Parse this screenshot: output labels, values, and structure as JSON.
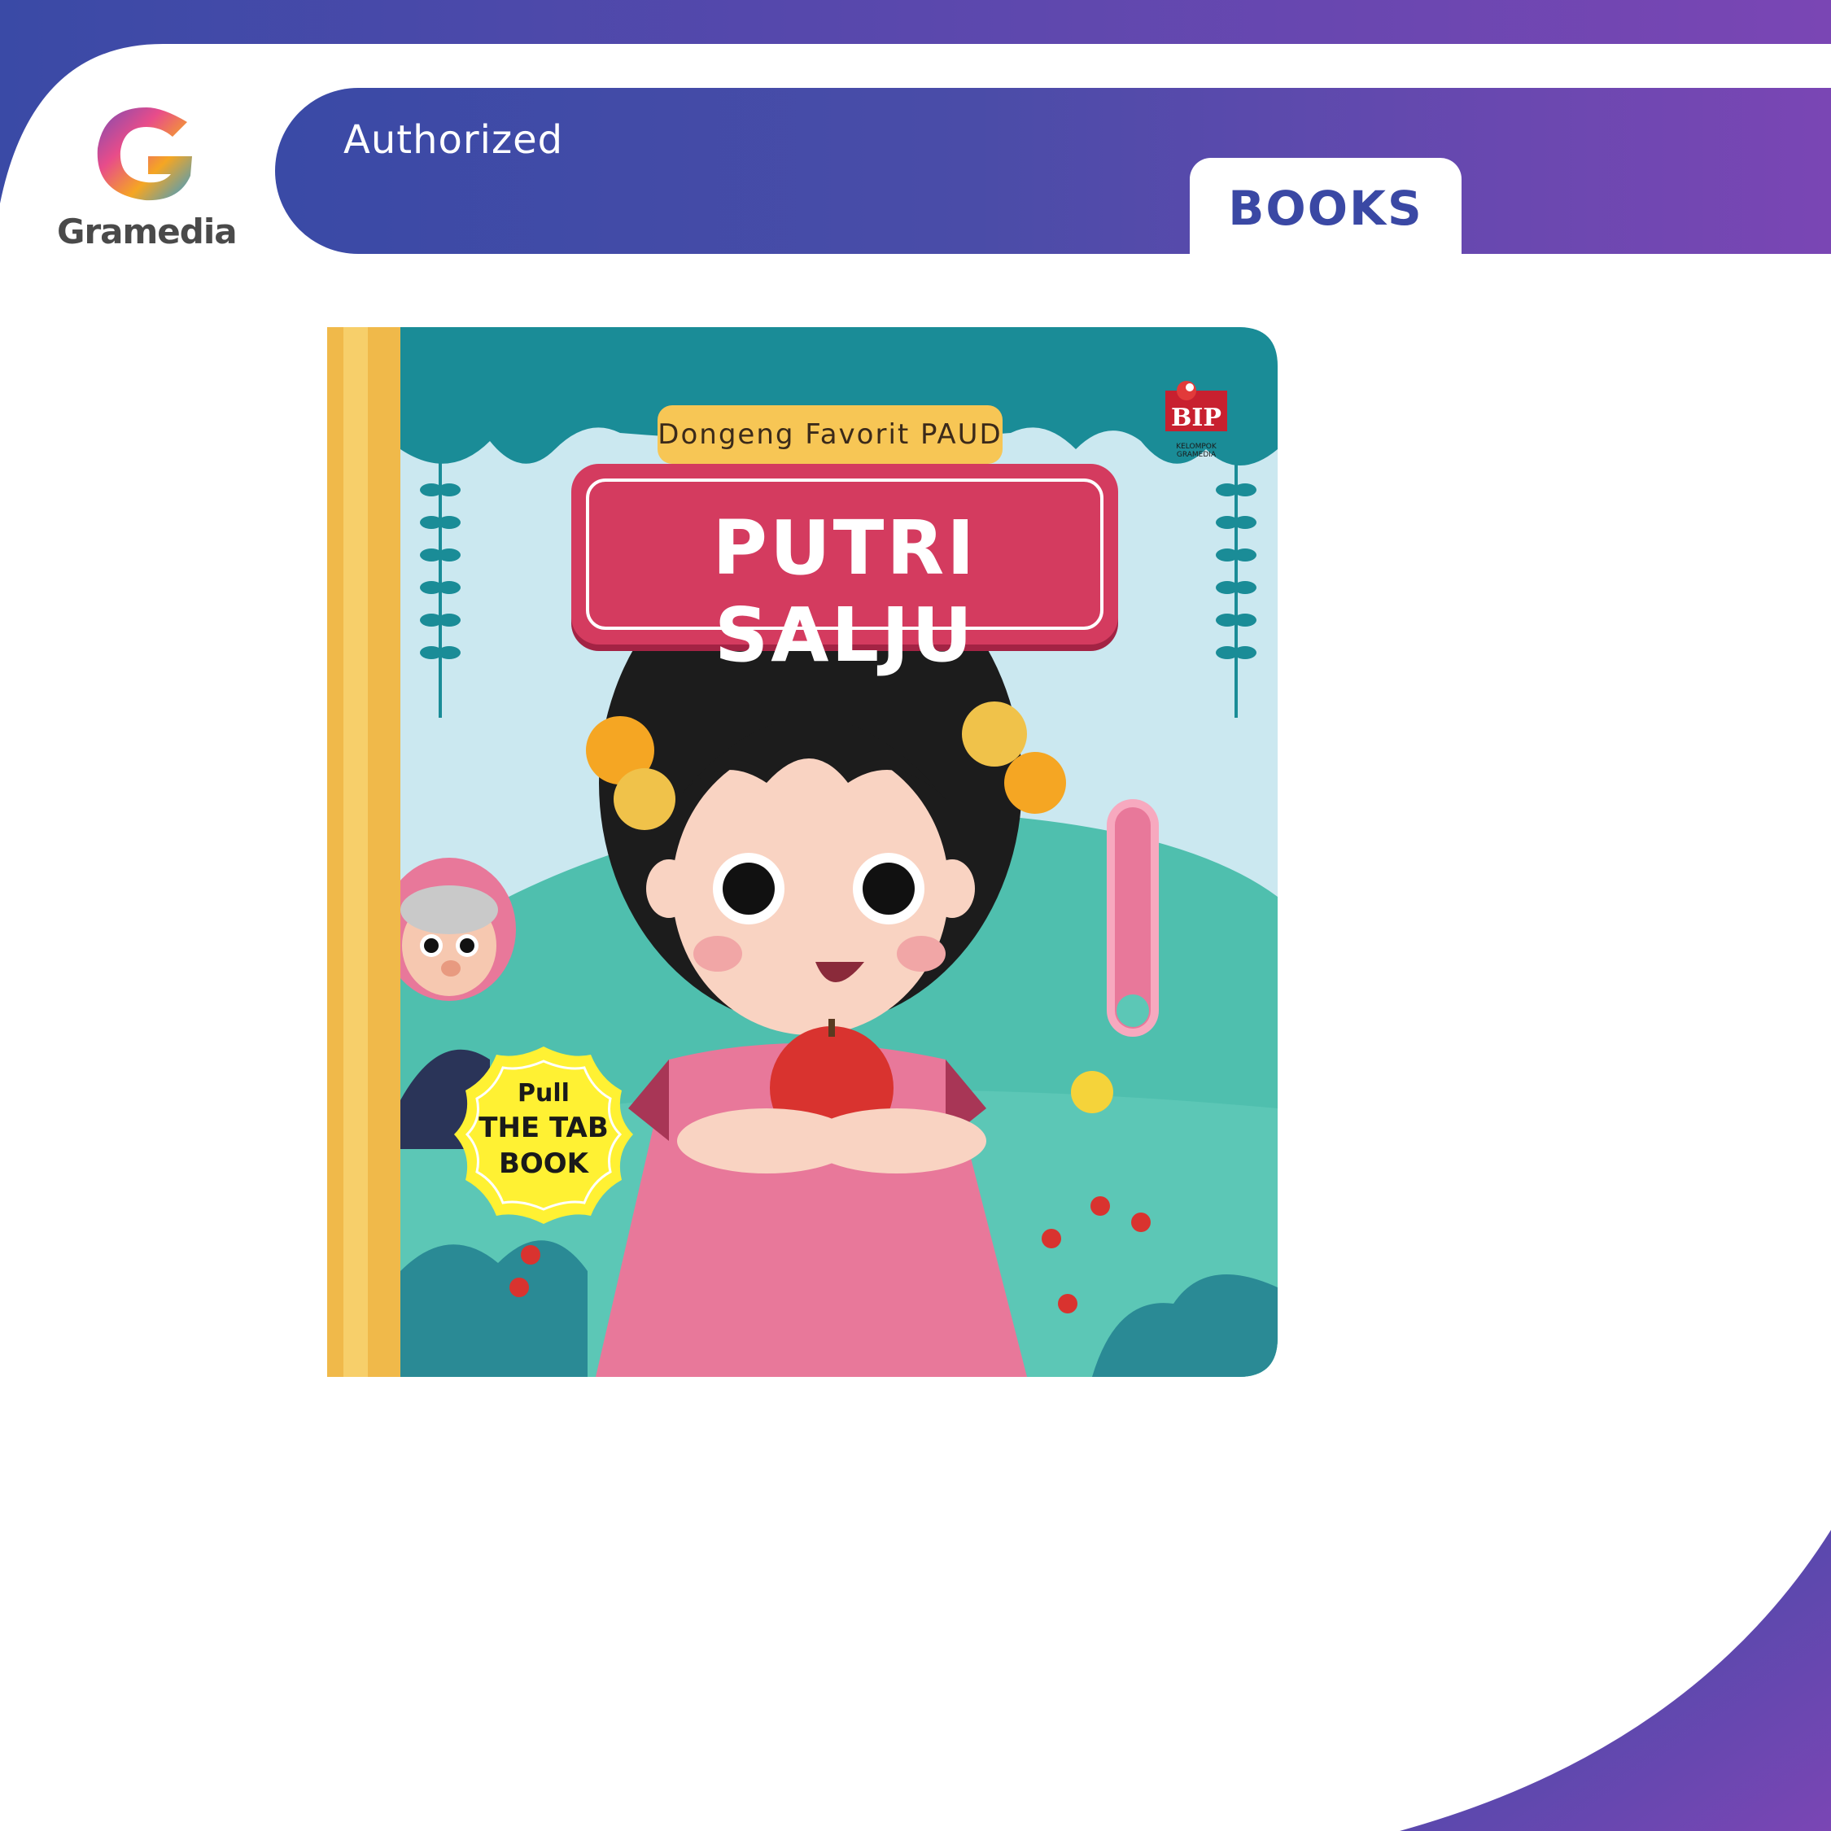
{
  "brand": {
    "name": "Gramedia",
    "tagline": "Authorized",
    "category": "BOOKS"
  },
  "book": {
    "series": "Dongeng Favorit PAUD",
    "title": "PUTRI SALJU",
    "badge_line1": "Pull",
    "badge_line2": "THE TAB",
    "badge_line3": "BOOK",
    "publisher": "BIP",
    "publisher_sub": "KELOMPOK GRAMEDIA"
  },
  "colors": {
    "brand_blue": "#3a48a4",
    "brand_purple": "#7a46b4",
    "title_red": "#d43b5f",
    "series_yellow": "#f7c655",
    "badge_yellow": "#fff133"
  },
  "icons": [
    "gramedia-logo-icon",
    "publisher-logo-icon"
  ]
}
